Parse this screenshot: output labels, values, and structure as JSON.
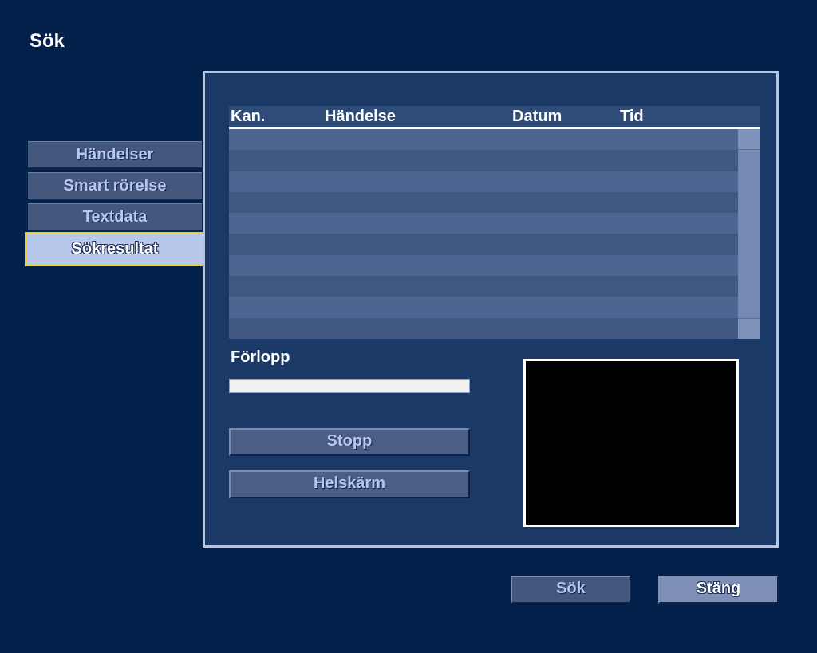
{
  "page": {
    "title": "Sök"
  },
  "tabs": [
    {
      "label": "Händelser",
      "active": false
    },
    {
      "label": "Smart rörelse",
      "active": false
    },
    {
      "label": "Textdata",
      "active": false
    },
    {
      "label": "Sökresultat",
      "active": true
    }
  ],
  "results": {
    "columns": [
      "Kan.",
      "Händelse",
      "Datum",
      "Tid"
    ],
    "rows": []
  },
  "progress": {
    "label": "Förlopp",
    "value_percent": 0
  },
  "buttons": {
    "stop_label": "Stopp",
    "fullscreen_label": "Helskärm",
    "search_label": "Sök",
    "close_label": "Stäng"
  },
  "colors": {
    "background": "#03214b",
    "panel": "#1b3966",
    "active_tab_border": "#f2cf1f"
  }
}
